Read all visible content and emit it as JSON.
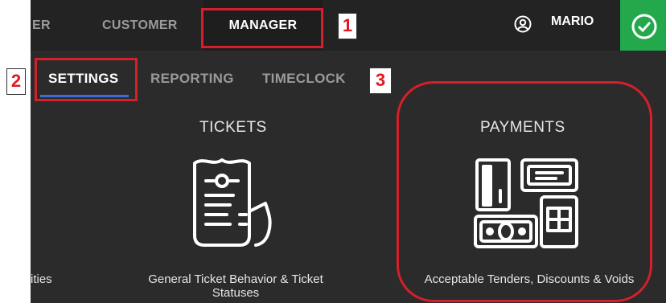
{
  "topnav": {
    "partial_tab": "ER",
    "customer": "CUSTOMER",
    "manager": "MANAGER",
    "user": "MARIO"
  },
  "subnav": {
    "settings": "SETTINGS",
    "reporting": "REPORTING",
    "timeclock": "TIMECLOCK"
  },
  "sections": {
    "left_partial_desc": "ities",
    "tickets": {
      "title": "TICKETS",
      "desc": "General Ticket Behavior & Ticket Statuses"
    },
    "payments": {
      "title": "PAYMENTS",
      "desc": "Acceptable Tenders, Discounts & Voids"
    }
  },
  "annotations": {
    "n1": "1",
    "n2": "2",
    "n3": "3"
  },
  "colors": {
    "highlight": "#d51f2b",
    "accent": "#24a84c",
    "underline": "#3a6fd8"
  },
  "icons": [
    "user-circle-icon",
    "checkmark-icon",
    "receipt-icon",
    "payments-icon"
  ]
}
